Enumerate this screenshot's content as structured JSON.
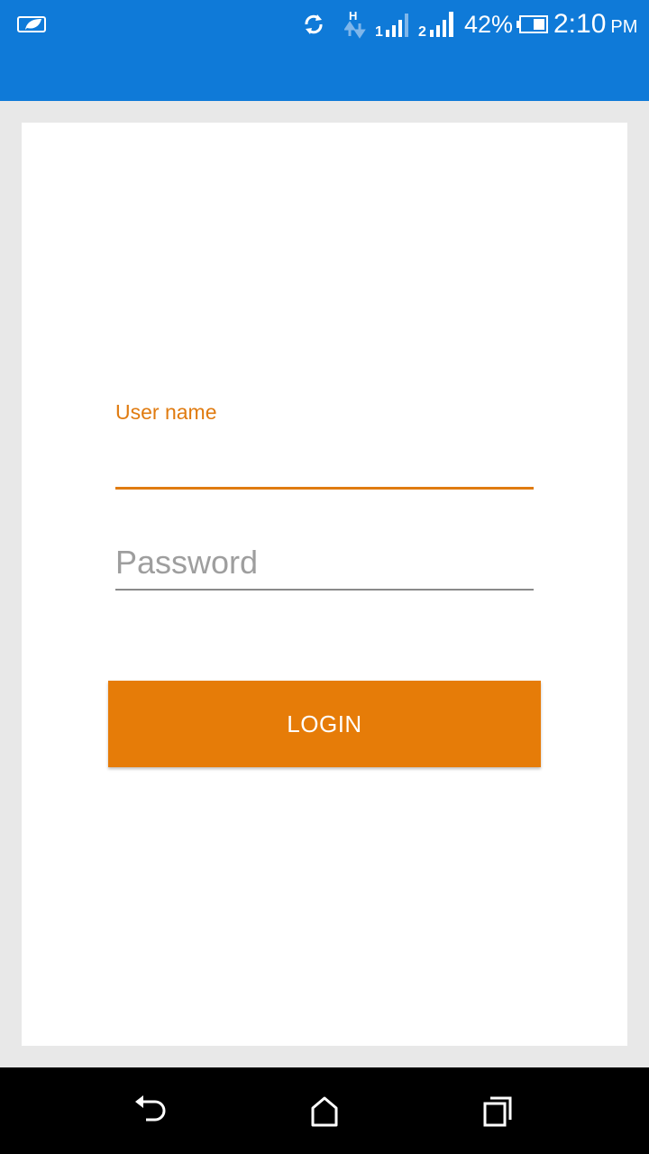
{
  "status_bar": {
    "icons": [
      "leaf-icon",
      "sync-icon",
      "h-data-icon",
      "signal-sim1-icon",
      "signal-sim2-icon",
      "battery-icon"
    ],
    "sim1_label": "1",
    "sim2_label": "2",
    "network_type": "H",
    "battery_percent": "42%",
    "time": "2:10",
    "ampm": "PM",
    "background_color": "#0f7ad8"
  },
  "login_form": {
    "username_label": "User name",
    "username_value": "",
    "password_placeholder": "Password",
    "password_value": "",
    "login_button_label": "LOGIN",
    "accent_color": "#e67c08"
  },
  "nav_bar": {
    "icons": [
      "back-icon",
      "home-icon",
      "recents-icon"
    ]
  }
}
